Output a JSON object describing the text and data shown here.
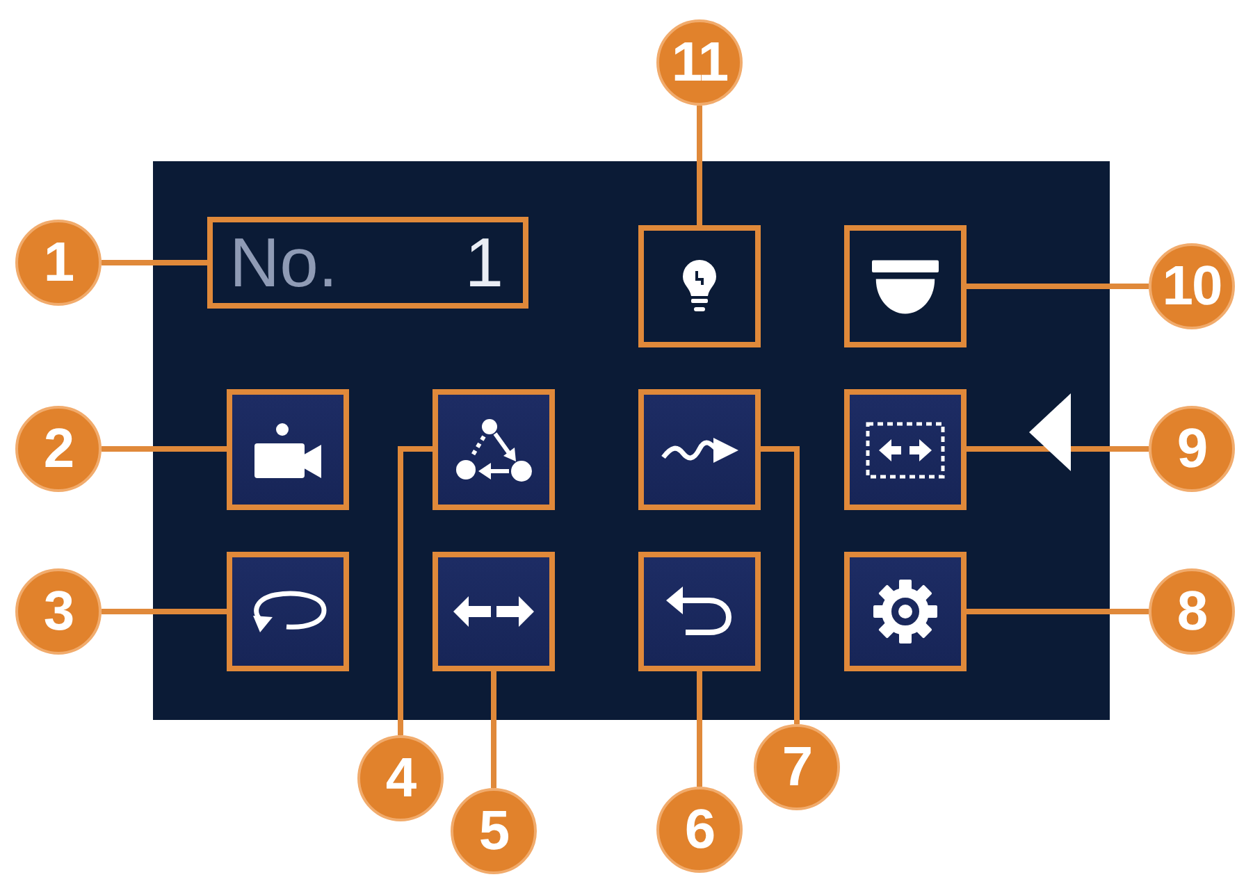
{
  "panel": {
    "channel_field": {
      "label": "No.",
      "value": "1"
    }
  },
  "callouts": [
    {
      "number": "11"
    },
    {
      "number": "1"
    },
    {
      "number": "10"
    },
    {
      "number": "2"
    },
    {
      "number": "9"
    },
    {
      "number": "3"
    },
    {
      "number": "8"
    },
    {
      "number": "4"
    },
    {
      "number": "7"
    },
    {
      "number": "5"
    },
    {
      "number": "6"
    }
  ]
}
